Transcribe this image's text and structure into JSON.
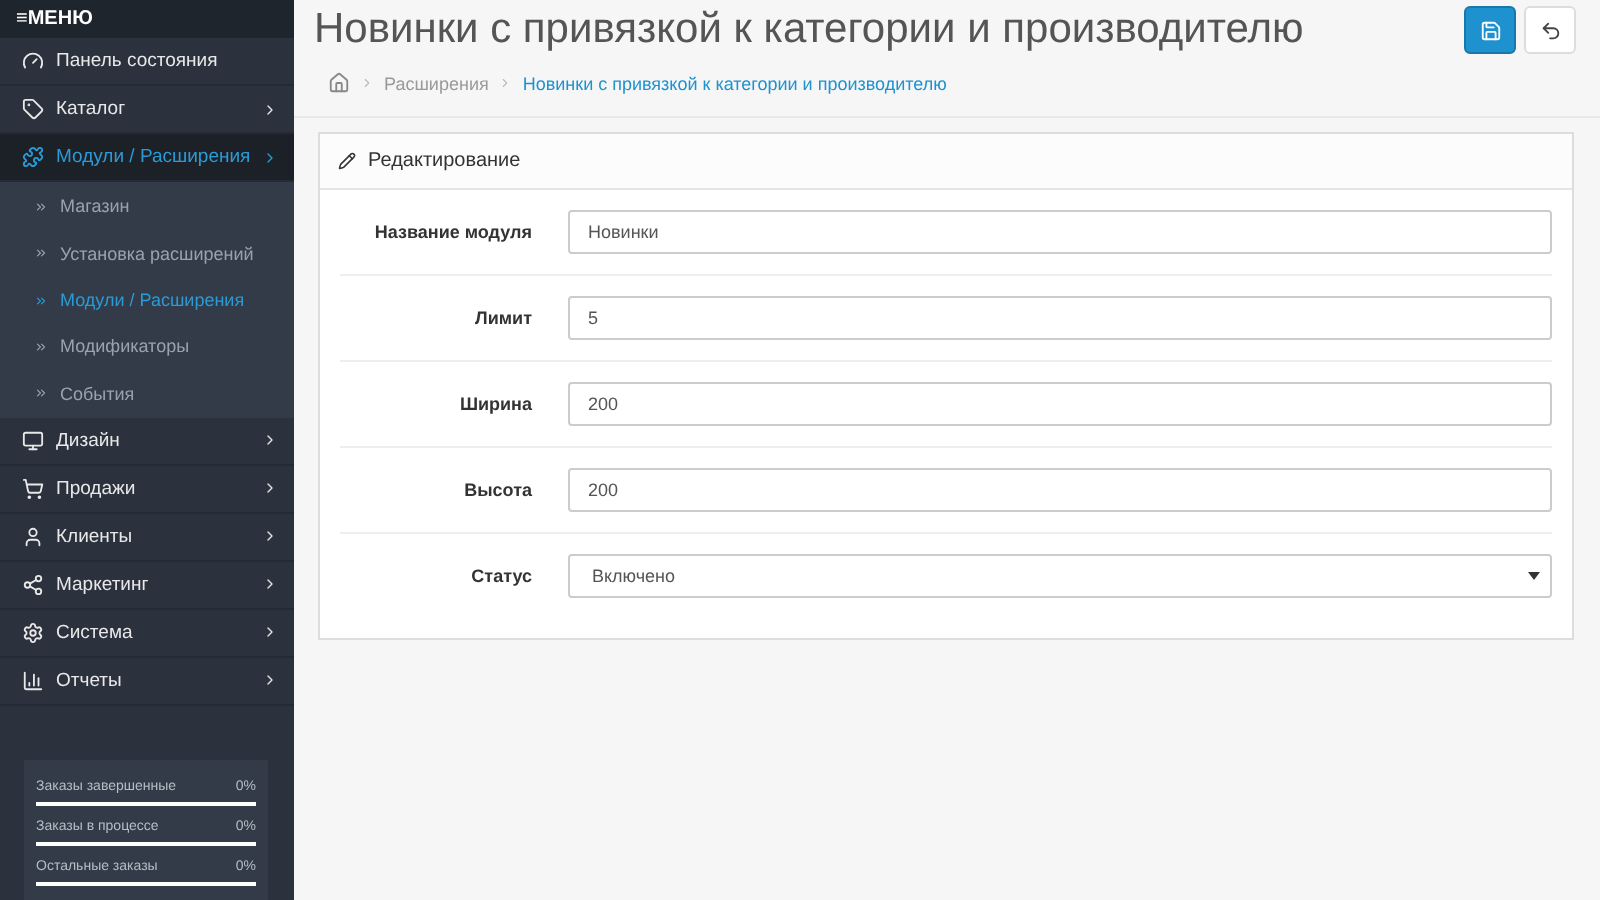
{
  "sidebar": {
    "menu_icon": "≡",
    "menu_label": "МЕНЮ",
    "items": [
      {
        "label": "Панель состояния",
        "selected": false,
        "has_arrow": false
      },
      {
        "label": "Каталог",
        "selected": false,
        "has_arrow": true
      },
      {
        "label": "Модули / Расширения",
        "selected": true,
        "has_arrow": true,
        "children": [
          {
            "label": "Магазин",
            "selected": false
          },
          {
            "label": "Установка расширений",
            "selected": false
          },
          {
            "label": "Модули / Расширения",
            "selected": true
          },
          {
            "label": "Модификаторы",
            "selected": false
          },
          {
            "label": "События",
            "selected": false
          }
        ]
      },
      {
        "label": "Дизайн",
        "selected": false,
        "has_arrow": true
      },
      {
        "label": "Продажи",
        "selected": false,
        "has_arrow": true
      },
      {
        "label": "Клиенты",
        "selected": false,
        "has_arrow": true
      },
      {
        "label": "Маркетинг",
        "selected": false,
        "has_arrow": true
      },
      {
        "label": "Система",
        "selected": false,
        "has_arrow": true
      },
      {
        "label": "Отчеты",
        "selected": false,
        "has_arrow": true
      }
    ],
    "stats": [
      {
        "label": "Заказы завершенные",
        "value": "0%",
        "level": 0
      },
      {
        "label": "Заказы в процессе",
        "value": "0%",
        "level": 0
      },
      {
        "label": "Остальные заказы",
        "value": "0%",
        "level": 0
      }
    ]
  },
  "page": {
    "title": "Новинки с привязкой к категории и производителю",
    "breadcrumb": [
      {
        "label": "Расширения",
        "current": false
      },
      {
        "label": "Новинки с привязкой к категории и производителю",
        "current": true
      }
    ]
  },
  "panel": {
    "title": "Редактирование",
    "fields": [
      {
        "label": "Название модуля",
        "value": "Новинки",
        "kind": "text"
      },
      {
        "label": "Лимит",
        "value": "5",
        "kind": "text"
      },
      {
        "label": "Ширина",
        "value": "200",
        "kind": "text"
      },
      {
        "label": "Высота",
        "value": "200",
        "kind": "text"
      },
      {
        "label": "Статус",
        "value": "Включено",
        "kind": "select"
      }
    ]
  }
}
